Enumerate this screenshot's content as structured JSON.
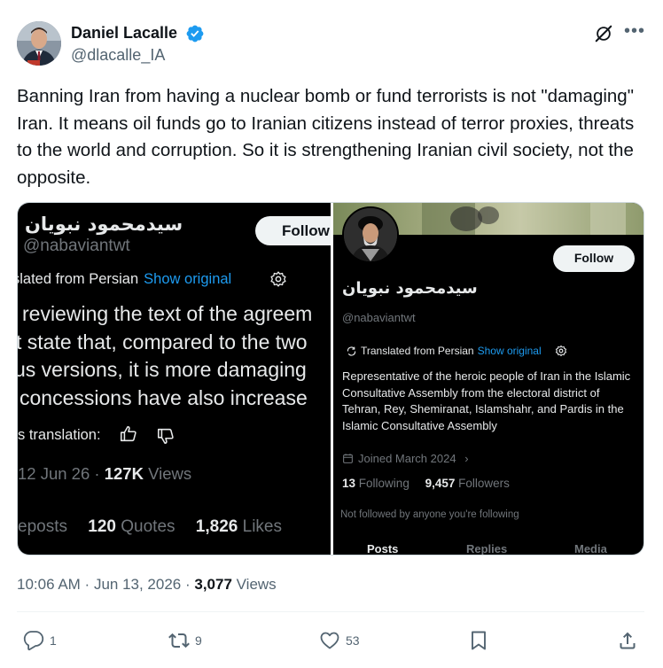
{
  "author": {
    "name": "Daniel Lacalle",
    "handle": "@dlacalle_IA"
  },
  "tweet": {
    "text": "Banning Iran from having a nuclear bomb or fund terrorists is not \"damaging\" Iran. It means oil funds go to Iranian citizens instead of terror proxies, threats to the world and corruption. So it is strengthening Iranian civil society, not the opposite."
  },
  "left_panel": {
    "name": "سیدمحمود نبویان",
    "handle": "@nabaviantwt",
    "follow_label": "Follow",
    "translated_label": "slated from Persian",
    "show_original": "Show original",
    "body_lines": [
      "reviewing the text of the agreem",
      "t state that, compared to the two",
      "us versions, it is more damaging",
      "concessions have also increase"
    ],
    "rate_label": "s translation:",
    "date": "12 Jun 26",
    "views_count": "127K",
    "views_label": "Views",
    "reposts_label": "eposts",
    "quotes_count": "120",
    "quotes_label": "Quotes",
    "likes_count": "1,826",
    "likes_label": "Likes"
  },
  "right_panel": {
    "follow_label": "Follow",
    "name": "سیدمحمود نبویان",
    "handle": "@nabaviantwt",
    "translated_label": "Translated from Persian",
    "show_original": "Show original",
    "bio": "Representative of the heroic people of Iran in the Islamic Consultative Assembly from the electoral district of Tehran, Rey, Shemiranat, Islamshahr, and Pardis in the Islamic Consultative Assembly",
    "joined": "Joined March 2024",
    "following_count": "13",
    "following_label": "Following",
    "followers_count": "9,457",
    "followers_label": "Followers",
    "not_followed": "Not followed by anyone you're following",
    "tabs": [
      "Posts",
      "Replies",
      "Media"
    ]
  },
  "meta": {
    "time": "10:06 AM",
    "date": "Jun 13, 2026",
    "views_count": "3,077",
    "views_label": "Views"
  },
  "actions": {
    "replies": "1",
    "reposts": "9",
    "likes": "53"
  },
  "colors": {
    "accent": "#1d9bf0",
    "text": "#0f1419",
    "secondary": "#536471"
  },
  "icons": [
    "verified-badge-icon",
    "grok-icon",
    "more-icon",
    "reply-icon",
    "repost-icon",
    "like-icon",
    "bookmark-icon",
    "share-icon",
    "gear-icon",
    "thumbs-up-icon",
    "thumbs-down-icon",
    "calendar-icon",
    "chevron-right-icon",
    "translate-icon"
  ]
}
